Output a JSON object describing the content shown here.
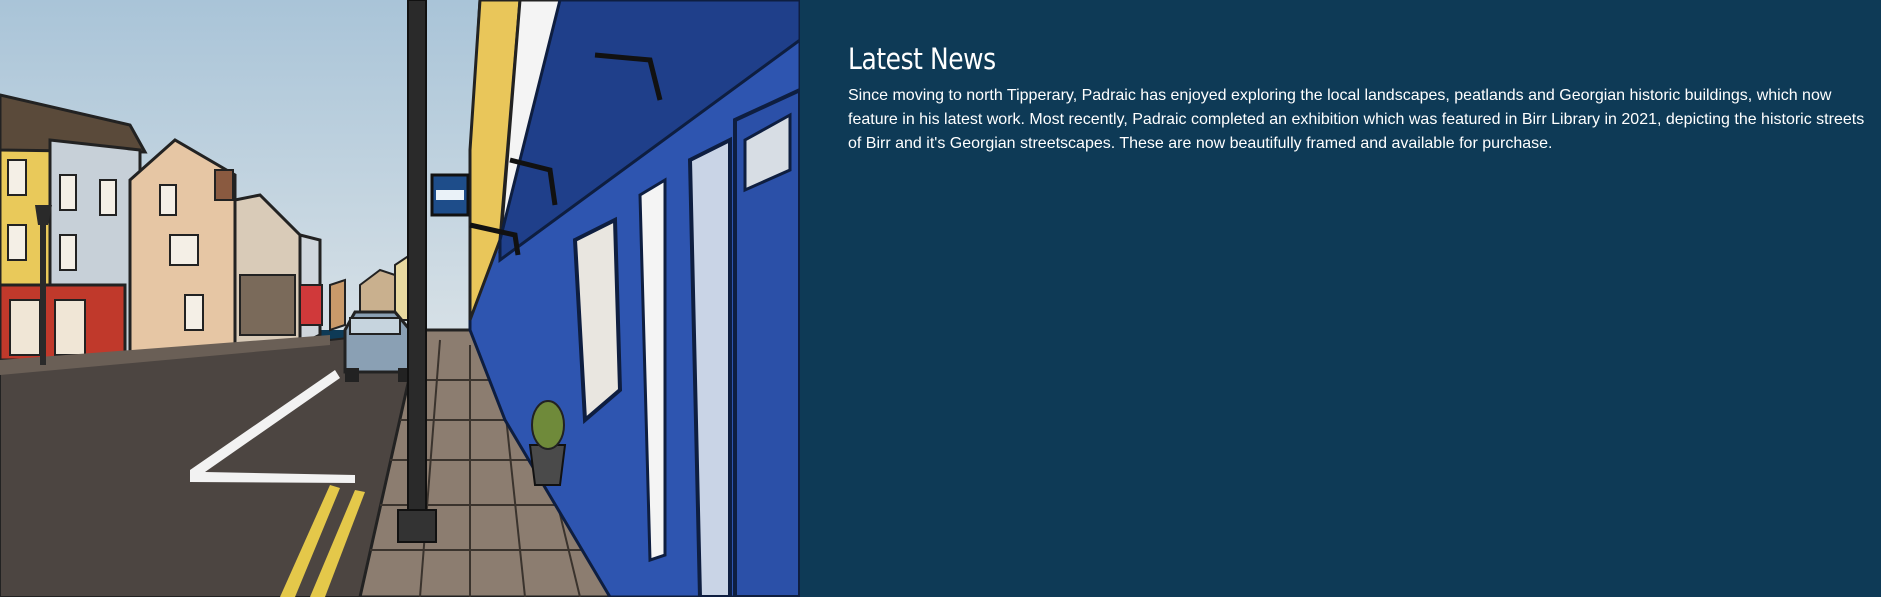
{
  "painting": {
    "icon": "street-painting-image"
  },
  "news": {
    "heading": "Latest News",
    "body": "Since moving to north Tipperary, Padraic has enjoyed exploring the local landscapes, peatlands and Georgian historic buildings, which now feature in his latest work. Most recently, Padraic completed an exhibition which was featured in Birr Library in 2021, depicting the historic streets of Birr and it's Georgian streetscapes. These are now beautifully framed and available for purchase."
  },
  "colors": {
    "panel_background": "#0e3a56",
    "text": "#ffffff"
  }
}
